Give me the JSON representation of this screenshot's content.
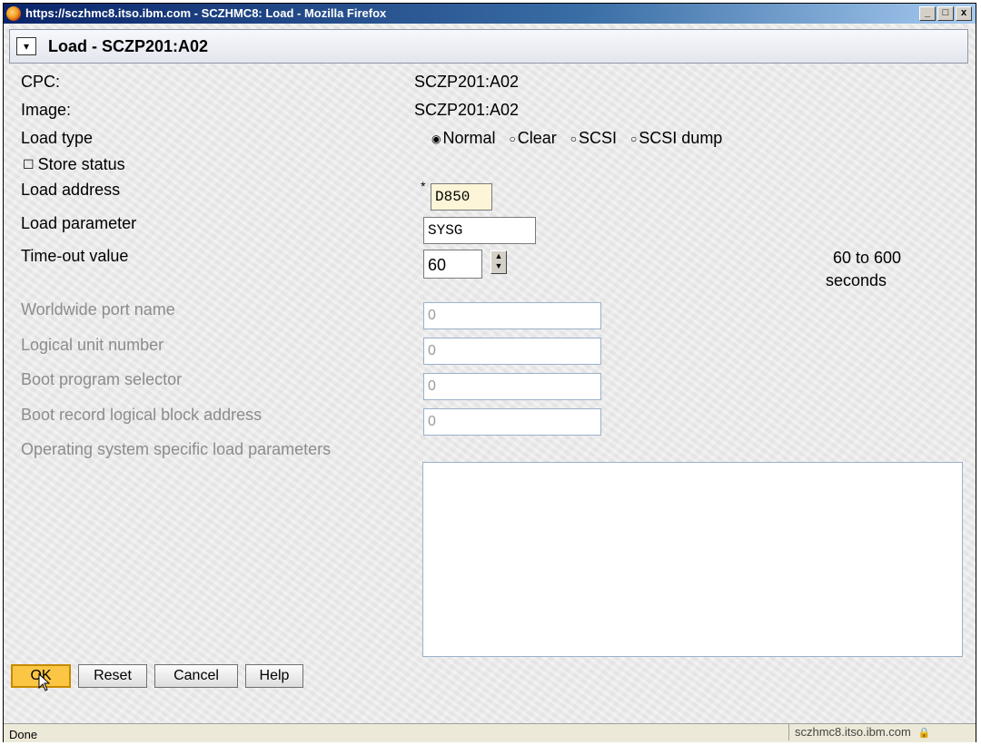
{
  "window": {
    "title": "https://sczhmc8.itso.ibm.com - SCZHMC8: Load - Mozilla Firefox",
    "controls": {
      "minimize": "_",
      "maximize": "□",
      "close": "x"
    }
  },
  "dialog": {
    "title": "Load - SCZP201:A02",
    "collapse_glyph": "▾"
  },
  "form": {
    "cpc_label": "CPC:",
    "cpc_value": "SCZP201:A02",
    "image_label": "Image:",
    "image_value": "SCZP201:A02",
    "load_type_label": "Load type",
    "load_type_options": [
      {
        "label": "Normal",
        "selected": true
      },
      {
        "label": "Clear",
        "selected": false
      },
      {
        "label": "SCSI",
        "selected": false
      },
      {
        "label": "SCSI dump",
        "selected": false
      }
    ],
    "store_status_label": "Store status",
    "store_status_checked": false,
    "load_address_label": "Load address",
    "load_address_value": "D850",
    "required_marker": "*",
    "load_parameter_label": "Load parameter",
    "load_parameter_value": "SYSG",
    "timeout_label": "Time-out value",
    "timeout_value": "60",
    "timeout_hint_1": "60 to 600",
    "timeout_hint_2": "seconds",
    "wwpn_label": "Worldwide port name",
    "wwpn_value": "0",
    "lun_label": "Logical unit number",
    "lun_value": "0",
    "bps_label": "Boot program selector",
    "bps_value": "0",
    "brlba_label": "Boot record logical block address",
    "brlba_value": "0",
    "os_params_label": "Operating system specific load parameters",
    "os_params_value": ""
  },
  "buttons": {
    "ok": "OK",
    "reset": "Reset",
    "cancel": "Cancel",
    "help": "Help"
  },
  "statusbar": {
    "text": "Done",
    "host": "sczhmc8.itso.ibm.com"
  },
  "colors": {
    "titlebar_start": "#0a246a",
    "titlebar_end": "#a6caf0",
    "ok_button": "#fbc644",
    "disabled_text": "#8c8c8c"
  }
}
